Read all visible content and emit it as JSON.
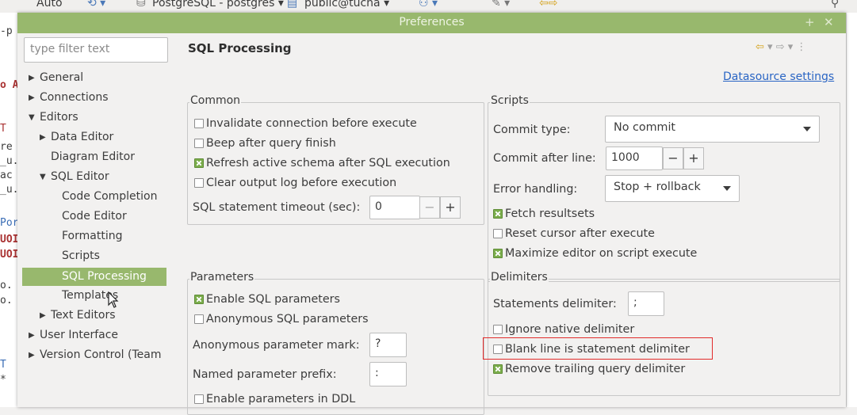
{
  "toolbar": {
    "auto_label": "Auto",
    "connection_label": "PostgreSQL - postgres",
    "schema_label": "public@tucha"
  },
  "background_editor": {
    "lines": [
      "-p",
      "o A",
      "T",
      "re",
      "_u.",
      "ac",
      "_u.",
      "Por",
      "UOI",
      "UOI",
      "o.",
      "o.",
      "T",
      "*"
    ]
  },
  "dialog": {
    "title": "Preferences",
    "filter_placeholder": "type filter text",
    "tree": [
      {
        "label": "General",
        "arrow": "right"
      },
      {
        "label": "Connections",
        "arrow": "right"
      },
      {
        "label": "Editors",
        "arrow": "down"
      },
      {
        "label": "Data Editor",
        "arrow": "right"
      },
      {
        "label": "Diagram Editor",
        "arrow": ""
      },
      {
        "label": "SQL Editor",
        "arrow": "down"
      },
      {
        "label": "Code Completion",
        "arrow": ""
      },
      {
        "label": "Code Editor",
        "arrow": ""
      },
      {
        "label": "Formatting",
        "arrow": ""
      },
      {
        "label": "Scripts",
        "arrow": ""
      },
      {
        "label": "SQL Processing",
        "arrow": "",
        "selected": true
      },
      {
        "label": "Templates",
        "arrow": ""
      },
      {
        "label": "Text Editors",
        "arrow": "right"
      },
      {
        "label": "User Interface",
        "arrow": "right"
      },
      {
        "label": "Version Control (Team",
        "arrow": "right"
      }
    ],
    "page_title": "SQL Processing",
    "datasource_link": "Datasource settings",
    "common": {
      "legend": "Common",
      "invalidate": {
        "label": "Invalidate connection before execute",
        "checked": false
      },
      "beep": {
        "label": "Beep after query finish",
        "checked": false
      },
      "refresh": {
        "label": "Refresh active schema after SQL execution",
        "checked": true
      },
      "clear_log": {
        "label": "Clear output log before execution",
        "checked": false
      },
      "timeout_label": "SQL statement timeout (sec):",
      "timeout_value": "0"
    },
    "scripts": {
      "legend": "Scripts",
      "commit_type_label": "Commit type:",
      "commit_type_value": "No commit",
      "commit_after_label": "Commit after line:",
      "commit_after_value": "1000",
      "error_handling_label": "Error handling:",
      "error_handling_value": "Stop + rollback",
      "fetch": {
        "label": "Fetch resultsets",
        "checked": true
      },
      "reset_cursor": {
        "label": "Reset cursor after execute",
        "checked": false
      },
      "maximize": {
        "label": "Maximize editor on script execute",
        "checked": true
      }
    },
    "parameters": {
      "legend": "Parameters",
      "enable": {
        "label": "Enable SQL parameters",
        "checked": true
      },
      "anonymous": {
        "label": "Anonymous SQL parameters",
        "checked": false
      },
      "mark_label": "Anonymous parameter mark:",
      "mark_value": "?",
      "prefix_label": "Named parameter prefix:",
      "prefix_value": ":",
      "ddl": {
        "label": "Enable parameters in DDL",
        "checked": false
      }
    },
    "delimiters": {
      "legend": "Delimiters",
      "statements_label": "Statements delimiter:",
      "statements_value": ";",
      "ignore_native": {
        "label": "Ignore native delimiter",
        "checked": false
      },
      "blank_line": {
        "label": "Blank line is statement delimiter",
        "checked": false
      },
      "remove_trailing": {
        "label": "Remove trailing query delimiter",
        "checked": true
      }
    },
    "colors": {
      "title_bar": "#98b86d",
      "selection": "#98b86d",
      "highlight": "#e22b2b",
      "link": "#2a65c4"
    }
  }
}
